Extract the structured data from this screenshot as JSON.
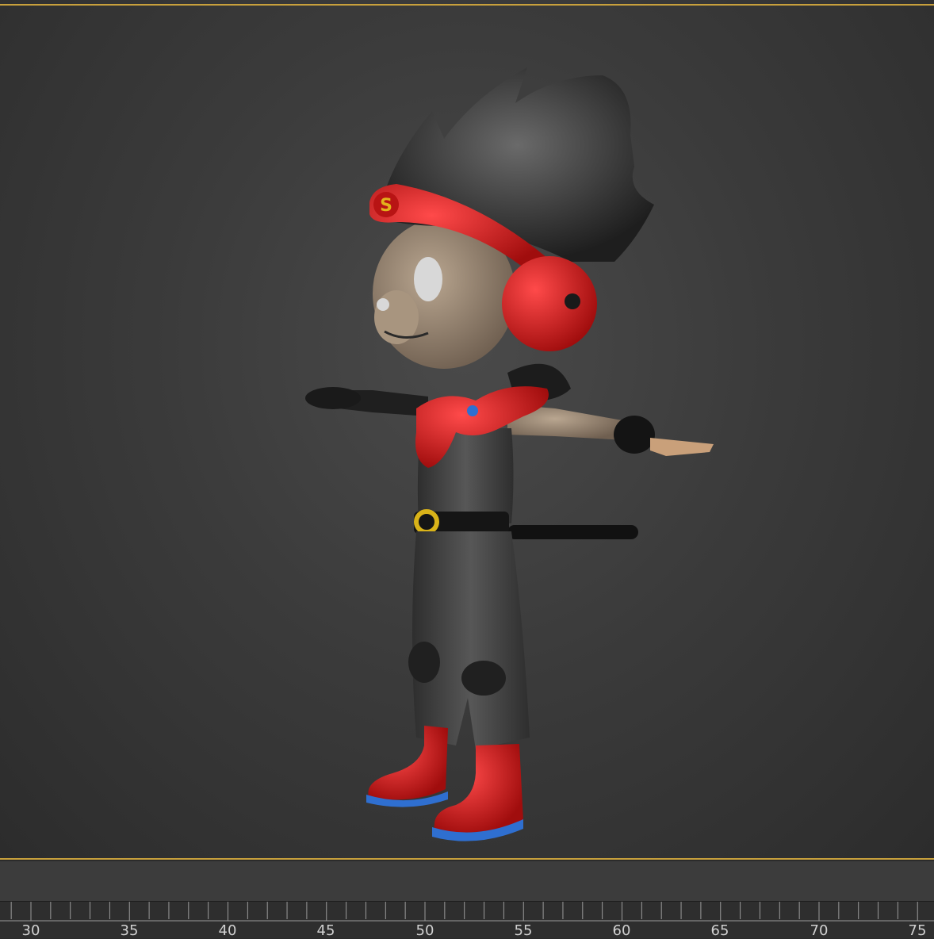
{
  "viewport": {
    "frame_color": "#c8a03c",
    "background": "#3b3b3b"
  },
  "character": {
    "headband_emblem": "S",
    "colors": {
      "hair": "#3a3a3a",
      "skin": "#a08f7c",
      "red_accent": "#d81c1c",
      "suit": "#4a4a4a",
      "boot_sole": "#2f6fd0",
      "buckle": "#d9b319"
    }
  },
  "timeline": {
    "ticks": [
      "30",
      "35",
      "40",
      "45",
      "50",
      "55",
      "60",
      "65",
      "70",
      "75"
    ]
  }
}
